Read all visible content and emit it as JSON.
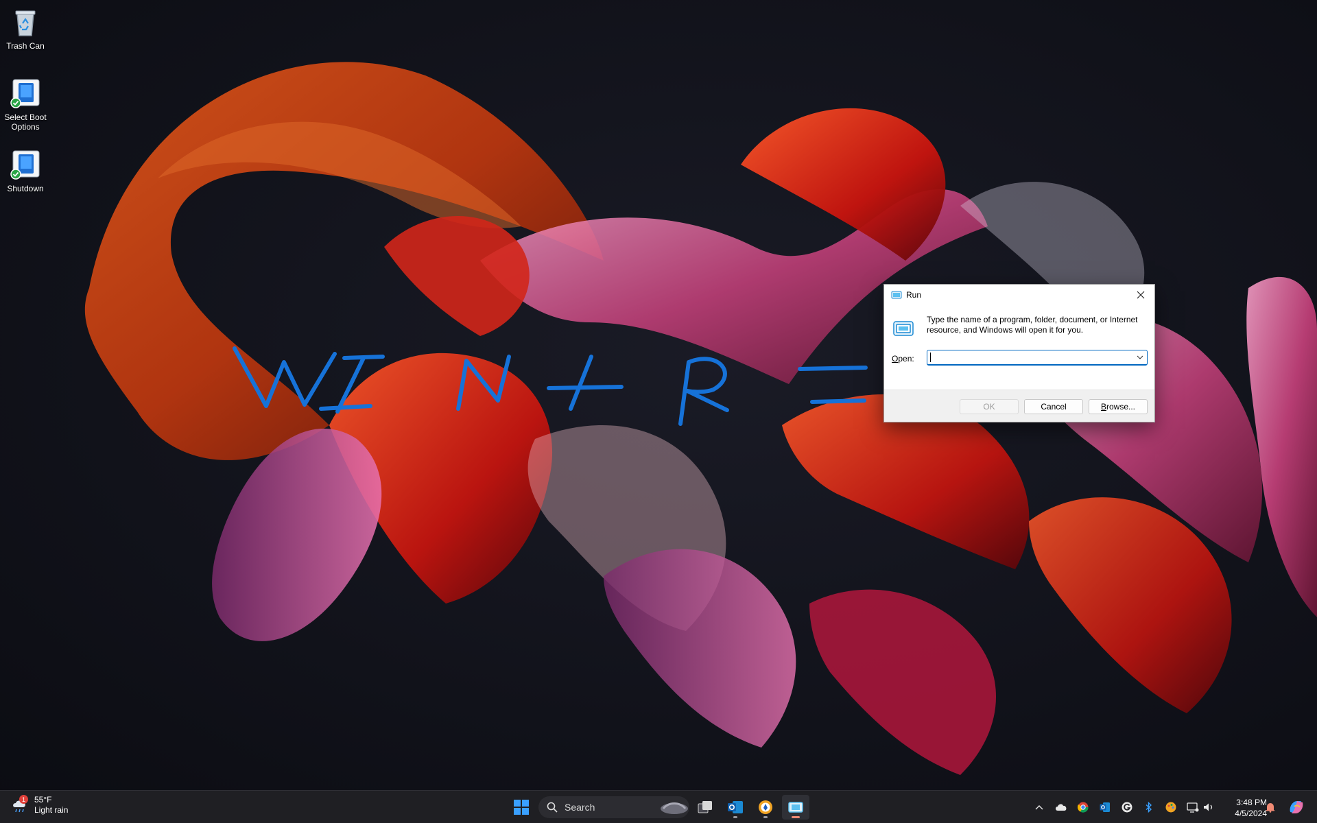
{
  "desktop": {
    "icons": [
      {
        "label": "Trash Can"
      },
      {
        "label": "Select Boot Options"
      },
      {
        "label": "Shutdown"
      }
    ],
    "annotation": "WIN + R ="
  },
  "run_dialog": {
    "title": "Run",
    "description": "Type the name of a program, folder, document, or Internet resource, and Windows will open it for you.",
    "open_label_accel": "O",
    "open_label_rest": "pen:",
    "open_value": "",
    "ok_label": "OK",
    "cancel_label": "Cancel",
    "browse_label_accel": "B",
    "browse_label_rest": "rowse..."
  },
  "taskbar": {
    "weather": {
      "badge": "1",
      "temp": "55°F",
      "condition": "Light rain"
    },
    "search_label": "Search",
    "clock": {
      "time": "3:48 PM",
      "date": "4/5/2024"
    },
    "colors": {
      "accent": "#0067c0",
      "active_indicator": "#f08a74"
    }
  }
}
